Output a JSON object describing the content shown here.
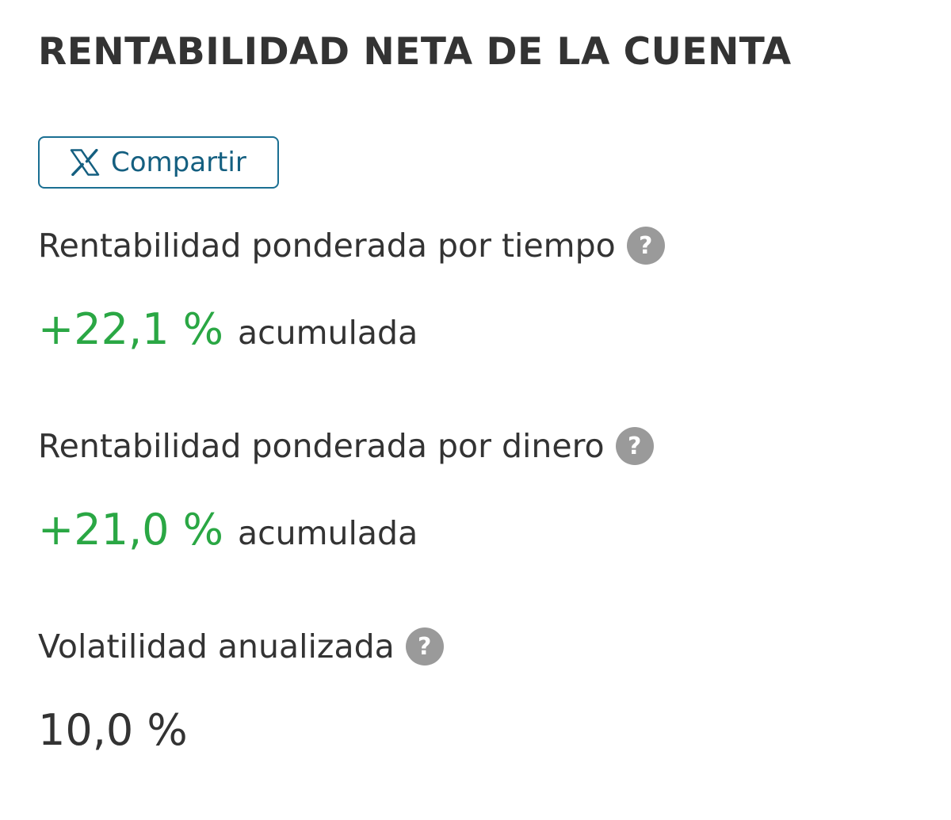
{
  "header": {
    "title": "RENTABILIDAD NETA DE LA CUENTA"
  },
  "share": {
    "label": "Compartir",
    "icon": "x-logo-icon"
  },
  "metrics": [
    {
      "label": "Rentabilidad ponderada por tiempo",
      "help_icon": "?",
      "value": "+22,1 %",
      "suffix": "acumulada"
    },
    {
      "label": "Rentabilidad ponderada por dinero",
      "help_icon": "?",
      "value": "+21,0 %",
      "suffix": "acumulada"
    },
    {
      "label": "Volatilidad anualizada",
      "help_icon": "?",
      "value": "10,0 %"
    }
  ],
  "colors": {
    "positive": "#2aa744",
    "accent": "#1a6f92",
    "text": "#333333",
    "help_icon_bg": "#9a9a9a"
  }
}
